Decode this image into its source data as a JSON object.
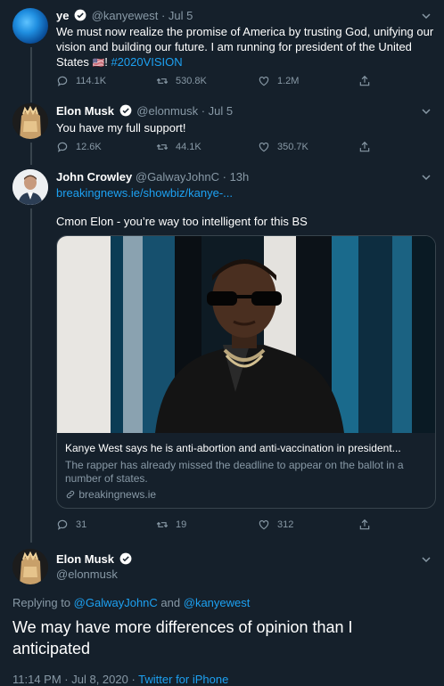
{
  "tweets": {
    "ye": {
      "name": "ye",
      "handle": "@kanyewest",
      "date": "· Jul 5",
      "text_line1": "We must now realize the promise of America by trusting God, unifying our",
      "text_line2": "vision and building our future. I am running for president of the United",
      "text_line3_a": "States",
      "text_line3_flag": "🇺🇸",
      "text_line3_b": "!",
      "hashtag": "#2020VISION",
      "replies": "114.1K",
      "retweets": "530.8K",
      "likes": "1.2M"
    },
    "musk1": {
      "name": "Elon Musk",
      "handle": "@elonmusk",
      "date": "· Jul 5",
      "text": "You have my full support!",
      "replies": "12.6K",
      "retweets": "44.1K",
      "likes": "350.7K"
    },
    "crowley": {
      "name": "John Crowley",
      "handle": "@GalwayJohnC",
      "date": "· 13h",
      "link": "breakingnews.ie/showbiz/kanye-...",
      "text": "Cmon Elon - you’re way too intelligent for this BS",
      "card_title": "Kanye West says he is anti-abortion and anti-vaccination in president...",
      "card_desc": "The rapper has already missed the deadline to appear on the ballot in a number of states.",
      "card_domain": "breakingnews.ie",
      "replies": "31",
      "retweets": "19",
      "likes": "312"
    },
    "musk2": {
      "name": "Elon Musk",
      "handle": "@elonmusk",
      "replying_prefix": "Replying to",
      "replying_user1": "@GalwayJohnC",
      "replying_and": "and",
      "replying_user2": "@kanyewest",
      "text_line1": "We may have more differences of opinion than I",
      "text_line2": "anticipated",
      "timestamp": "11:14 PM · Jul 8, 2020 ·",
      "source": "Twitter for iPhone"
    }
  },
  "colors": {
    "background": "#15202b",
    "accent": "#1da1f2",
    "muted": "#8899a6",
    "border": "#38444d"
  }
}
